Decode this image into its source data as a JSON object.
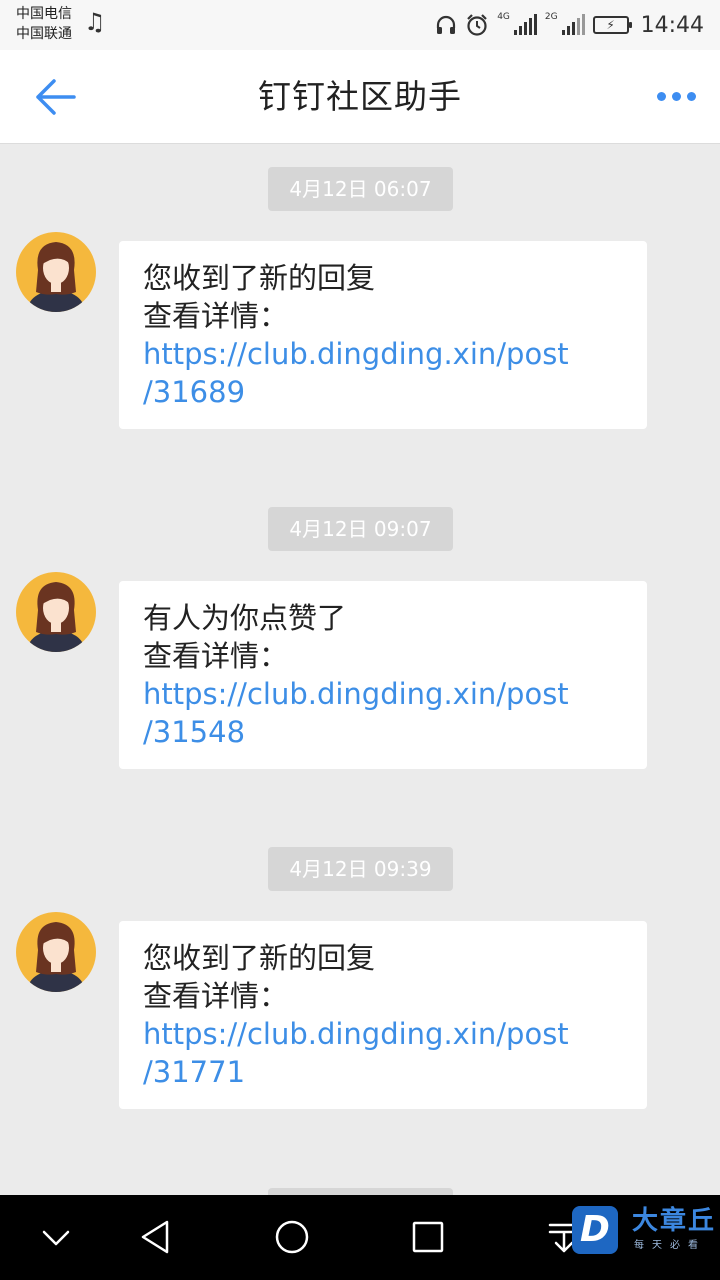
{
  "status_bar": {
    "carrier_1": "中国电信",
    "carrier_2": "中国联通",
    "net_1": "4G",
    "net_2": "2G",
    "time": "14:44"
  },
  "header": {
    "title": "钉钉社区助手"
  },
  "messages": [
    {
      "timestamp": "4月12日 06:07",
      "line1": "您收到了新的回复",
      "line2": "查看详情：",
      "link_part1": "https://club.dingding.xin/post",
      "link_part2": "/31689"
    },
    {
      "timestamp": "4月12日 09:07",
      "line1": "有人为你点赞了",
      "line2": "查看详情：",
      "link_part1": "https://club.dingding.xin/post",
      "link_part2": "/31548"
    },
    {
      "timestamp": "4月12日 09:39",
      "line1": "您收到了新的回复",
      "line2": "查看详情：",
      "link_part1": "https://club.dingding.xin/post",
      "link_part2": "/31771"
    }
  ],
  "watermark": {
    "logo_letter": "D",
    "name": "大章丘",
    "slogan": "每天必看"
  },
  "colors": {
    "accent": "#3d8df1",
    "link": "#3d8ee6",
    "background": "#ebebeb",
    "timestamp_bg": "#d6d6d6",
    "avatar_bg": "#f5b83d",
    "navbar": "#000000"
  },
  "icons": {
    "back": "arrow-left-icon",
    "more": "more-dots-icon",
    "music": "music-note-icon",
    "headphones": "headphones-icon",
    "alarm": "alarm-icon",
    "battery": "battery-charging-icon",
    "nav_down": "chevron-down-icon",
    "nav_back": "triangle-back-icon",
    "nav_home": "circle-home-icon",
    "nav_recent": "square-recent-icon",
    "nav_notify": "pull-down-icon"
  }
}
